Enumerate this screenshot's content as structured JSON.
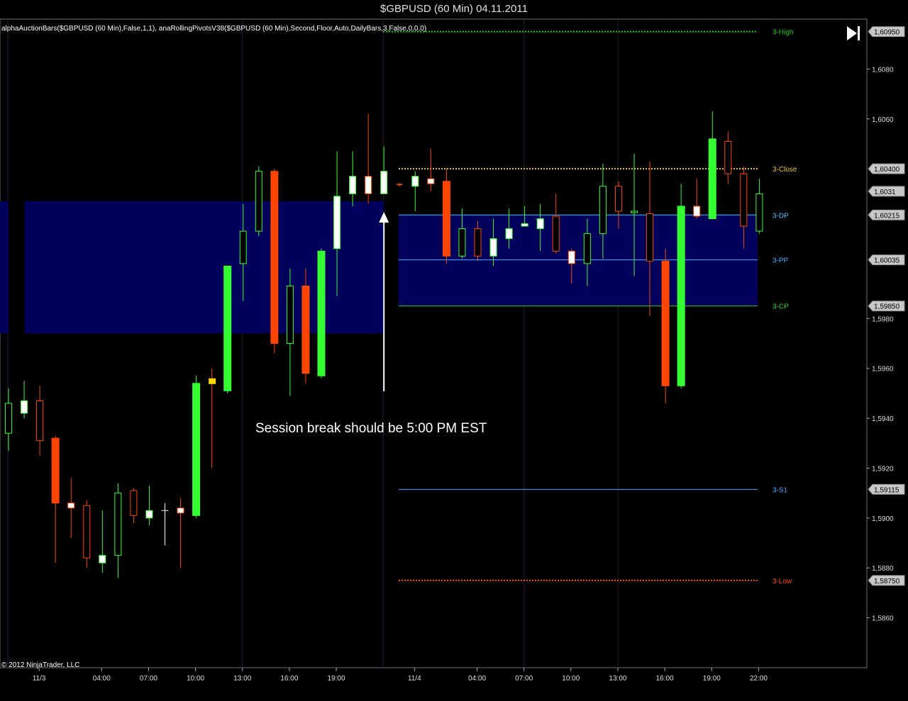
{
  "window": {
    "title": "$GBPUSD (60 Min)  04.11.2011"
  },
  "indicator_text": "alphaAuctionBars($GBPUSD (60 Min),False,1,1),  anaRollingPivotsV38($GBPUSD (60 Min),Second,Floor,Auto,DailyBars,3,False,0,0,0)",
  "copyright": "© 2012 NinjaTrader, LLC",
  "annotation": "Session break should be 5:00 PM EST",
  "colors": {
    "background": "#000000",
    "up_bar": "#33ff33",
    "down_bar": "#ff4500",
    "value_area": "#00005c",
    "high_line": "#22cc22",
    "close_line": "#e8c830",
    "dp_line": "#40c8ff",
    "pp_line": "#40b0ff",
    "cp_line": "#22dd22",
    "s1_line": "#3aa8ff",
    "low_line": "#ff4500"
  },
  "chart_data": {
    "type": "candlestick",
    "title": "$GBPUSD (60 Min)  04.11.2011",
    "ylim": [
      1.584,
      1.61
    ],
    "y_ticks": [
      "1,6080",
      "1,6060",
      "1,5980",
      "1,5960",
      "1,5940",
      "1,5920",
      "1,5900",
      "1,5880",
      "1,5860"
    ],
    "x_ticks": [
      {
        "label": "11/3",
        "bar": 2
      },
      {
        "label": "04:00",
        "bar": 6
      },
      {
        "label": "07:00",
        "bar": 9
      },
      {
        "label": "10:00",
        "bar": 12
      },
      {
        "label": "13:00",
        "bar": 15
      },
      {
        "label": "16:00",
        "bar": 18
      },
      {
        "label": "19:00",
        "bar": 21
      },
      {
        "label": "11/4",
        "bar": 26
      },
      {
        "label": "04:00",
        "bar": 30
      },
      {
        "label": "07:00",
        "bar": 33
      },
      {
        "label": "10:00",
        "bar": 36
      },
      {
        "label": "13:00",
        "bar": 39
      },
      {
        "label": "16:00",
        "bar": 42
      },
      {
        "label": "19:00",
        "bar": 45
      },
      {
        "label": "22:00",
        "bar": 48
      }
    ],
    "price_labels": [
      {
        "text": "1,60950",
        "value": 1.6095
      },
      {
        "text": "1,60400",
        "value": 1.604
      },
      {
        "text": "1,6031",
        "value": 1.6031
      },
      {
        "text": "1,60215",
        "value": 1.60215
      },
      {
        "text": "1,60035",
        "value": 1.60035
      },
      {
        "text": "1,59850",
        "value": 1.5985
      },
      {
        "text": "1,59115",
        "value": 1.59115
      },
      {
        "text": "1,58750",
        "value": 1.5875
      }
    ],
    "pivots": [
      {
        "name": "3-High",
        "value": 1.6095,
        "style": "dotted",
        "color_key": "high_line"
      },
      {
        "name": "3-Close",
        "value": 1.604,
        "style": "dotted",
        "color_key": "close_line"
      },
      {
        "name": "3-DP",
        "value": 1.60215,
        "style": "solid",
        "color_key": "dp_line"
      },
      {
        "name": "3-PP",
        "value": 1.60035,
        "style": "solid",
        "color_key": "pp_line"
      },
      {
        "name": "3-CP",
        "value": 1.5985,
        "style": "solid",
        "color_key": "cp_line"
      },
      {
        "name": "3-S1",
        "value": 1.59115,
        "style": "solid",
        "color_key": "s1_line"
      },
      {
        "name": "3-Low",
        "value": 1.5875,
        "style": "dotted",
        "color_key": "low_line"
      }
    ],
    "prior_value_area": {
      "top": 1.6027,
      "bottom": 1.5974
    },
    "current_value_area": {
      "top": 1.60215,
      "bottom": 1.5985
    },
    "bars": [
      {
        "o": 1.5934,
        "h": 1.5952,
        "l": 1.5927,
        "c": 1.5946
      },
      {
        "o": 1.5942,
        "h": 1.5955,
        "l": 1.594,
        "c": 1.5947
      },
      {
        "o": 1.5947,
        "h": 1.5953,
        "l": 1.5925,
        "c": 1.5931
      },
      {
        "o": 1.5932,
        "h": 1.5933,
        "l": 1.5882,
        "c": 1.5906
      },
      {
        "o": 1.5906,
        "h": 1.5916,
        "l": 1.5892,
        "c": 1.5904
      },
      {
        "o": 1.5905,
        "h": 1.5907,
        "l": 1.588,
        "c": 1.5884
      },
      {
        "o": 1.5882,
        "h": 1.5903,
        "l": 1.5878,
        "c": 1.5885
      },
      {
        "o": 1.5885,
        "h": 1.5914,
        "l": 1.5876,
        "c": 1.591
      },
      {
        "o": 1.5911,
        "h": 1.5912,
        "l": 1.5898,
        "c": 1.5901
      },
      {
        "o": 1.59,
        "h": 1.5913,
        "l": 1.5897,
        "c": 1.5903
      },
      {
        "o": 1.5903,
        "h": 1.5906,
        "l": 1.5889,
        "c": 1.5903
      },
      {
        "o": 1.5904,
        "h": 1.5908,
        "l": 1.588,
        "c": 1.5902
      },
      {
        "o": 1.5901,
        "h": 1.5957,
        "l": 1.59,
        "c": 1.5954
      },
      {
        "o": 1.5955,
        "h": 1.596,
        "l": 1.592,
        "c": 1.5952
      },
      {
        "o": 1.5951,
        "h": 1.5988,
        "l": 1.595,
        "c": 1.6001
      },
      {
        "o": 1.6002,
        "h": 1.6026,
        "l": 1.5987,
        "c": 1.6015
      },
      {
        "o": 1.6015,
        "h": 1.6041,
        "l": 1.6013,
        "c": 1.6039
      },
      {
        "o": 1.6039,
        "h": 1.604,
        "l": 1.5966,
        "c": 1.597
      },
      {
        "o": 1.597,
        "h": 1.6,
        "l": 1.5949,
        "c": 1.5993
      },
      {
        "o": 1.5993,
        "h": 1.6,
        "l": 1.5954,
        "c": 1.5958
      },
      {
        "o": 1.5957,
        "h": 1.6008,
        "l": 1.5956,
        "c": 1.6007
      },
      {
        "o": 1.6008,
        "h": 1.6047,
        "l": 1.5989,
        "c": 1.6029
      },
      {
        "o": 1.603,
        "h": 1.6047,
        "l": 1.6025,
        "c": 1.6037
      },
      {
        "o": 1.6037,
        "h": 1.6062,
        "l": 1.6026,
        "c": 1.603
      },
      {
        "o": 1.603,
        "h": 1.6049,
        "l": 1.603,
        "c": 1.6039
      },
      {
        "o": 1.6034,
        "h": 1.6034,
        "l": 1.6033,
        "c": 1.6033
      },
      {
        "o": 1.6033,
        "h": 1.6039,
        "l": 1.6023,
        "c": 1.6037
      },
      {
        "o": 1.6036,
        "h": 1.6048,
        "l": 1.6031,
        "c": 1.6034
      },
      {
        "o": 1.6035,
        "h": 1.604,
        "l": 1.6002,
        "c": 1.6005
      },
      {
        "o": 1.6005,
        "h": 1.6024,
        "l": 1.6004,
        "c": 1.6016
      },
      {
        "o": 1.6016,
        "h": 1.6019,
        "l": 1.6003,
        "c": 1.6005
      },
      {
        "o": 1.6005,
        "h": 1.602,
        "l": 1.6001,
        "c": 1.6012
      },
      {
        "o": 1.6012,
        "h": 1.6024,
        "l": 1.6008,
        "c": 1.6016
      },
      {
        "o": 1.6017,
        "h": 1.6025,
        "l": 1.6017,
        "c": 1.6018
      },
      {
        "o": 1.6016,
        "h": 1.6026,
        "l": 1.6007,
        "c": 1.602
      },
      {
        "o": 1.6021,
        "h": 1.603,
        "l": 1.6006,
        "c": 1.6007
      },
      {
        "o": 1.6007,
        "h": 1.6008,
        "l": 1.5994,
        "c": 1.6002
      },
      {
        "o": 1.6002,
        "h": 1.602,
        "l": 1.5993,
        "c": 1.6014
      },
      {
        "o": 1.6014,
        "h": 1.6042,
        "l": 1.6004,
        "c": 1.6033
      },
      {
        "o": 1.6033,
        "h": 1.6035,
        "l": 1.6016,
        "c": 1.6023
      },
      {
        "o": 1.6023,
        "h": 1.6046,
        "l": 1.5997,
        "c": 1.6023
      },
      {
        "o": 1.6022,
        "h": 1.6043,
        "l": 1.5981,
        "c": 1.6003
      },
      {
        "o": 1.6003,
        "h": 1.6008,
        "l": 1.5946,
        "c": 1.5953
      },
      {
        "o": 1.5953,
        "h": 1.6034,
        "l": 1.5952,
        "c": 1.6025
      },
      {
        "o": 1.6025,
        "h": 1.6036,
        "l": 1.602,
        "c": 1.6021
      },
      {
        "o": 1.602,
        "h": 1.6063,
        "l": 1.602,
        "c": 1.6052
      },
      {
        "o": 1.6051,
        "h": 1.6055,
        "l": 1.6034,
        "c": 1.6038
      },
      {
        "o": 1.6038,
        "h": 1.6041,
        "l": 1.6008,
        "c": 1.6017
      },
      {
        "o": 1.6015,
        "h": 1.6036,
        "l": 1.6014,
        "c": 1.603
      }
    ],
    "white_bars": [
      1,
      4,
      6,
      9,
      11,
      21,
      22,
      23,
      24,
      26,
      27,
      31,
      32,
      33,
      34,
      36,
      44
    ],
    "orange_small": [
      25
    ],
    "yellow_bars": [
      13
    ],
    "cross_bars": [
      10
    ]
  }
}
